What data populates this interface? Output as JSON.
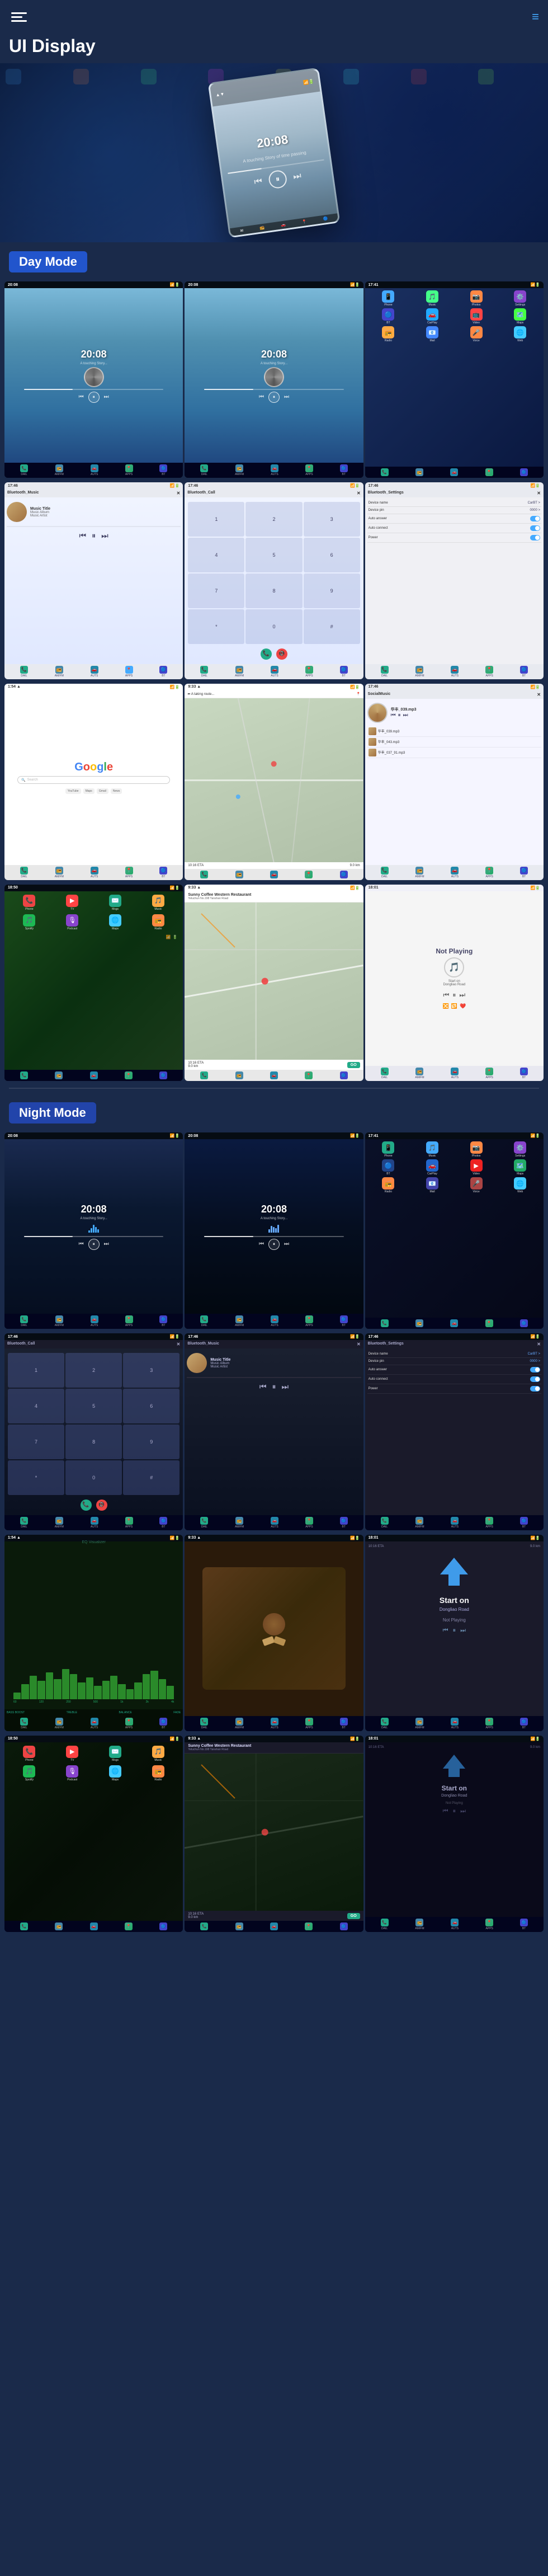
{
  "header": {
    "title": "UI Display",
    "menu_icon": "menu-icon",
    "nav_icon": "≡"
  },
  "hero": {
    "time": "20:08",
    "subtitle": "A touching Story of time passing"
  },
  "day_mode": {
    "label": "Day Mode",
    "screens": [
      {
        "type": "player",
        "time": "20:08",
        "subtitle": "A touching Story..."
      },
      {
        "type": "player",
        "time": "20:08",
        "subtitle": "A touching Story..."
      },
      {
        "type": "apps",
        "label": "App Grid"
      },
      {
        "type": "bluetooth_music",
        "title": "Bluetooth_Music",
        "track": "Music Title",
        "album": "Music Album",
        "artist": "Music Artist"
      },
      {
        "type": "bluetooth_call",
        "title": "Bluetooth_Call"
      },
      {
        "type": "bluetooth_settings",
        "title": "Bluetooth_Settings",
        "device_name_label": "Device name",
        "device_name_value": "CarBT",
        "device_pin_label": "Device pin",
        "device_pin_value": "0000",
        "auto_answer_label": "Auto answer",
        "auto_connect_label": "Auto connect",
        "power_label": "Power"
      },
      {
        "type": "google",
        "search_placeholder": "Search"
      },
      {
        "type": "nav_map",
        "label": "Navigation Map"
      },
      {
        "type": "local_music",
        "title": "SocialMusic",
        "tracks": [
          {
            "name": "华丰_039.mp3",
            "sub": ""
          },
          {
            "name": "华丰_043.mp3",
            "sub": ""
          },
          {
            "name": "华丰_037_91.mp3",
            "sub": ""
          }
        ]
      }
    ]
  },
  "day_mode_row2": {
    "screens": [
      {
        "type": "ios_apps",
        "apps": [
          "📞",
          "✉️",
          "📱",
          "🎵",
          "🎤",
          "📻",
          "🎧",
          "📺",
          "📷"
        ]
      },
      {
        "type": "waze_map",
        "restaurant_name": "Sunny Coffee Western Restaurant",
        "restaurant_address": "Yeluchun No.198 Yanshan Road",
        "eta_label": "10:16 ETA",
        "eta_time": "10:16",
        "distance": "9.0 km",
        "go_label": "GO"
      },
      {
        "type": "not_playing",
        "label": "Not Playing",
        "road": "Start on Dongliao Road"
      }
    ]
  },
  "night_mode": {
    "label": "Night Mode",
    "screens": [
      {
        "type": "player_night",
        "time": "20:08",
        "subtitle": "A touching Story..."
      },
      {
        "type": "player_night",
        "time": "20:08",
        "subtitle": "A touching Story..."
      },
      {
        "type": "apps_night",
        "label": "App Grid Night"
      },
      {
        "type": "bluetooth_call_night",
        "title": "Bluetooth_Call"
      },
      {
        "type": "bluetooth_music_night",
        "title": "Bluetooth_Music",
        "track": "Music Title",
        "album": "Music Album",
        "artist": "Music Artist"
      },
      {
        "type": "bluetooth_settings_night",
        "title": "Bluetooth_Settings",
        "device_name_label": "Device name",
        "device_name_value": "CarBT",
        "device_pin_label": "Device pin",
        "device_pin_value": "0000",
        "auto_answer_label": "Auto answer",
        "auto_connect_label": "Auto connect",
        "power_label": "Power"
      },
      {
        "type": "waveform_night",
        "label": "Waveform EQ"
      },
      {
        "type": "food_image",
        "label": "Food Image"
      },
      {
        "type": "highway_night",
        "label": "Highway Night"
      }
    ]
  },
  "night_mode_row2": {
    "screens": [
      {
        "type": "ios_apps_night"
      },
      {
        "type": "restaurant_map_night",
        "restaurant_name": "Sunny Coffee Western Restaurant",
        "restaurant_address": "Yeluchun No.198 Yanshan Road",
        "eta_label": "10:16 ETA",
        "distance": "9.0 km",
        "go_label": "GO"
      },
      {
        "type": "turn_nav_night",
        "distance": "9.0 km",
        "road": "Start on Dongliao Road",
        "not_playing": "Not Playing"
      }
    ]
  },
  "dock": {
    "items": [
      "📧",
      "📻",
      "🚗",
      "📍",
      "🔵"
    ]
  }
}
